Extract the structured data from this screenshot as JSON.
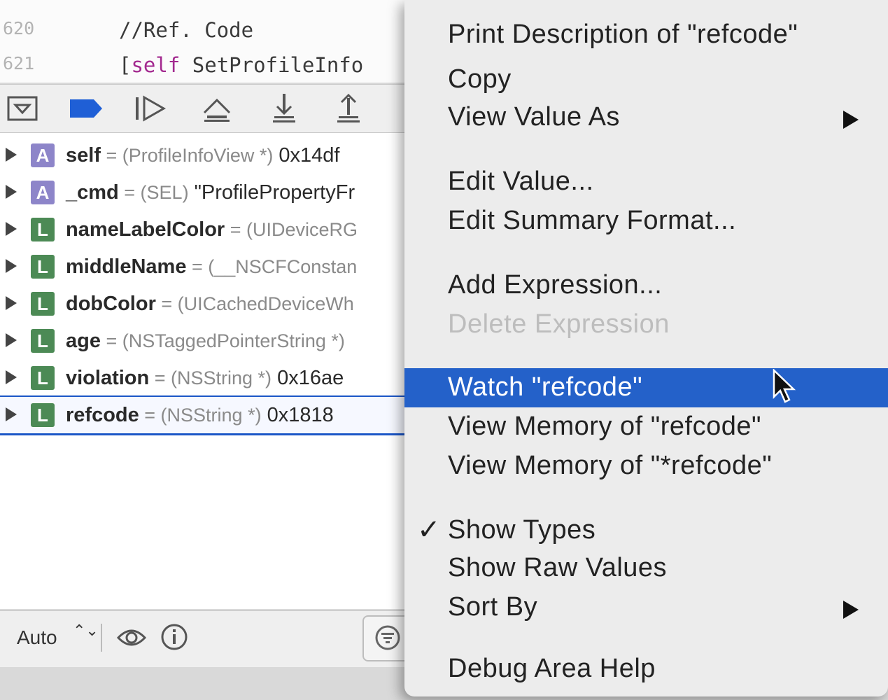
{
  "editor": {
    "lines": [
      {
        "num": "620",
        "text": "//Ref. Code"
      },
      {
        "num": "621",
        "bracket": "[",
        "keyword": "self",
        "rest": " SetProfileInfo"
      }
    ]
  },
  "toolbar": {
    "buttons": [
      "hide-debug-area",
      "breakpoint",
      "continue",
      "step-over",
      "step-into",
      "step-out"
    ]
  },
  "variables": [
    {
      "kind": "A",
      "name": "self",
      "eq": " = ",
      "type": "(ProfileInfoView *)",
      "value": " 0x14df"
    },
    {
      "kind": "A",
      "name": "_cmd",
      "eq": " = ",
      "type": "(SEL)",
      "value": " \"ProfilePropertyFr"
    },
    {
      "kind": "L",
      "name": "nameLabelColor",
      "eq": " = ",
      "type": "(UIDeviceRG",
      "value": ""
    },
    {
      "kind": "L",
      "name": "middleName",
      "eq": " = ",
      "type": "(__NSCFConstan",
      "value": ""
    },
    {
      "kind": "L",
      "name": "dobColor",
      "eq": " = ",
      "type": "(UICachedDeviceWh",
      "value": ""
    },
    {
      "kind": "L",
      "name": "age",
      "eq": " = ",
      "type": "(NSTaggedPointerString *)",
      "value": ""
    },
    {
      "kind": "L",
      "name": "violation",
      "eq": " = ",
      "type": "(NSString *)",
      "value": " 0x16ae"
    },
    {
      "kind": "L",
      "name": "refcode",
      "eq": " = ",
      "type": "(NSString *)",
      "value": " 0x1818"
    }
  ],
  "bottom_bar": {
    "scope_label": "Auto",
    "scope_arrows": "⌃⌄"
  },
  "menu": {
    "items": [
      {
        "label": "Print Description of \"refcode\""
      },
      {
        "label": "Copy"
      },
      {
        "label": "View Value As",
        "submenu": true
      },
      {
        "label": "Edit Value..."
      },
      {
        "label": "Edit Summary Format..."
      },
      {
        "label": "Add Expression..."
      },
      {
        "label": "Delete Expression",
        "disabled": true
      },
      {
        "label": "Watch \"refcode\"",
        "highlighted": true
      },
      {
        "label": "View Memory of \"refcode\""
      },
      {
        "label": "View Memory of \"*refcode\""
      },
      {
        "label": "Show Types",
        "checked": true
      },
      {
        "label": "Show Raw Values"
      },
      {
        "label": "Sort By",
        "submenu": true
      },
      {
        "label": "Debug Area Help"
      }
    ],
    "check_glyph": "✓"
  },
  "colors": {
    "highlight": "#2461c9",
    "badge_arg": "#8d85c9",
    "badge_local": "#4c8a55",
    "keyword": "#a3298f"
  }
}
